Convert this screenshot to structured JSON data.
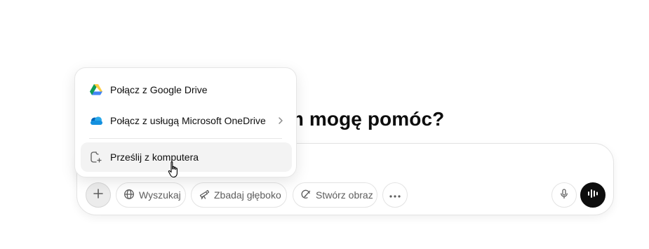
{
  "heading": {
    "text": "m mogę pomóc?"
  },
  "composer": {
    "plus_icon": "plus-icon",
    "tools": [
      {
        "label": "Wyszukaj",
        "icon": "globe-icon"
      },
      {
        "label": "Zbadaj głęboko",
        "icon": "telescope-icon"
      },
      {
        "label": "Stwórz obraz",
        "icon": "paint-icon"
      }
    ],
    "more_icon": "ellipsis-icon",
    "mic_icon": "microphone-icon",
    "voice_icon": "voice-mode-icon"
  },
  "attach_menu": {
    "items": [
      {
        "label": "Połącz z Google Drive",
        "icon": "google-drive-icon"
      },
      {
        "label": "Połącz z usługą Microsoft OneDrive",
        "icon": "onedrive-icon",
        "has_submenu": true
      },
      {
        "label": "Prześlij z komputera",
        "icon": "upload-file-icon",
        "hovered": true
      }
    ]
  },
  "colors": {
    "text": "#0d0d0d",
    "muted_text": "#5d5d5d",
    "voice_button": "#0d0d0d",
    "hover_bg": "#f3f3f3",
    "border": "#e3e3e3"
  }
}
